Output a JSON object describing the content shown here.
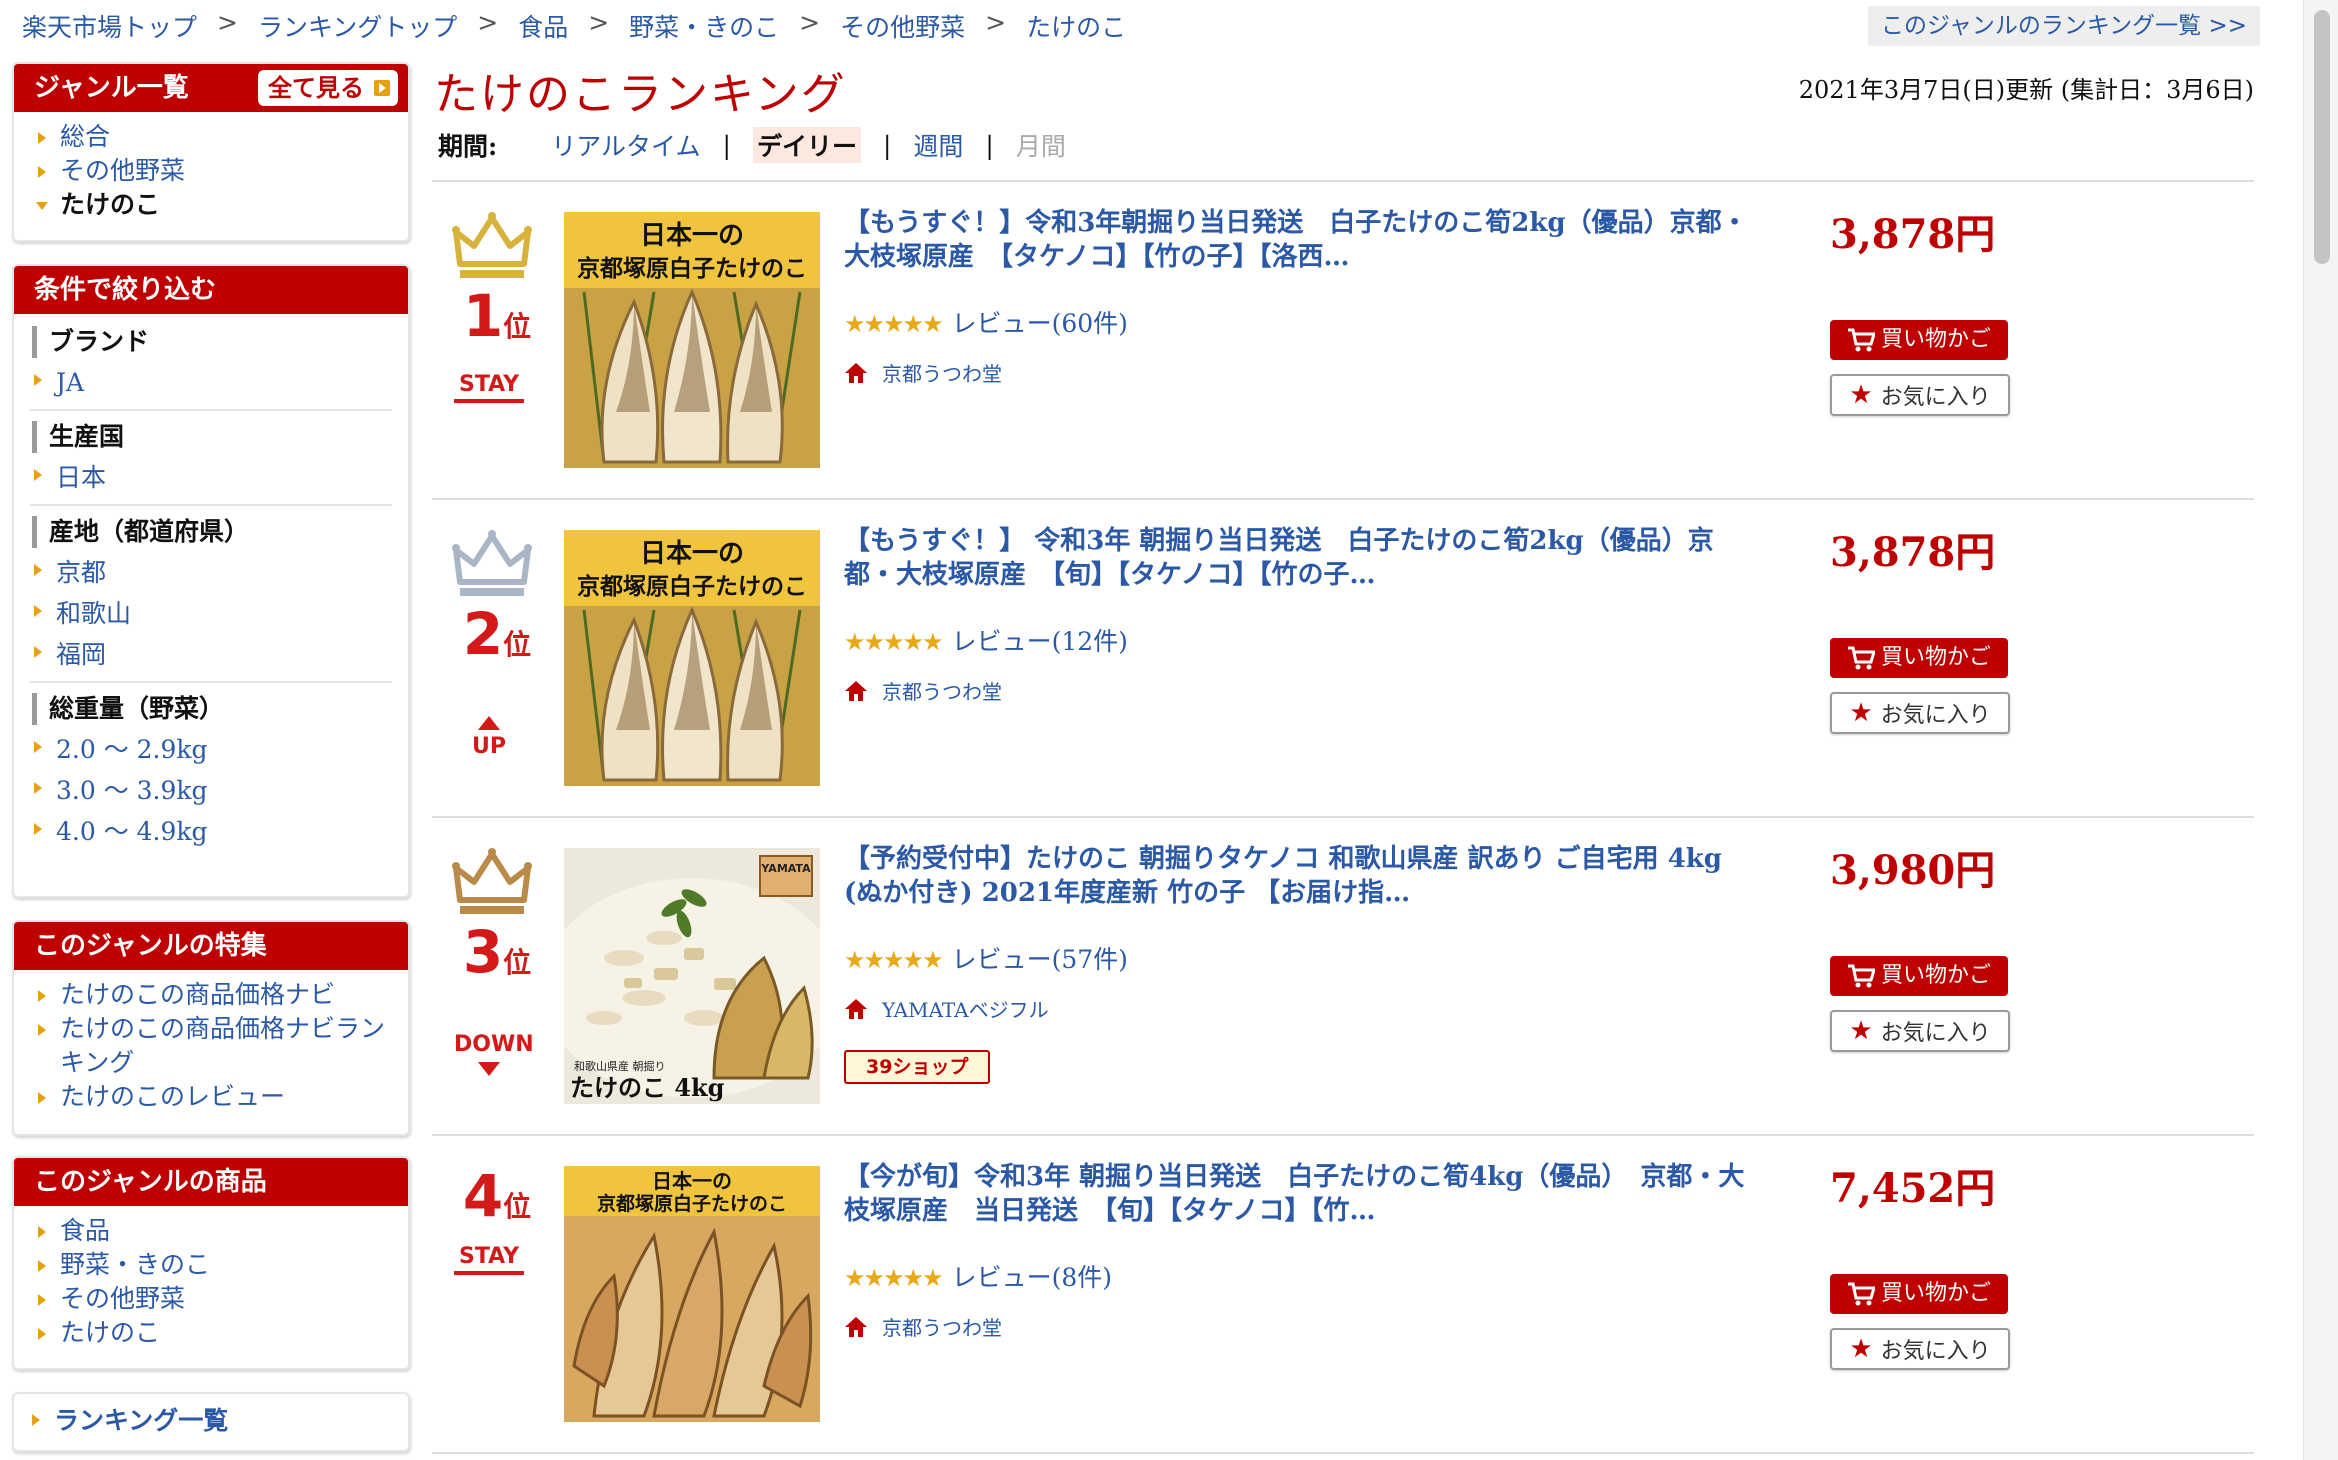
{
  "breadcrumb": [
    "楽天市場トップ",
    "ランキングトップ",
    "食品",
    "野菜・きのこ",
    "その他野菜",
    "たけのこ"
  ],
  "breadcrumb_separator": ">",
  "genre_ranking_link": "このジャンルのランキング一覧 >>",
  "sidebar": {
    "genre": {
      "title": "ジャンル一覧",
      "see_all": "全て見る",
      "items": [
        "総合",
        "その他野菜",
        "たけのこ"
      ]
    },
    "filter": {
      "title": "条件で絞り込む",
      "groups": [
        {
          "title": "ブランド",
          "items": [
            "JA"
          ]
        },
        {
          "title": "生産国",
          "items": [
            "日本"
          ]
        },
        {
          "title": "産地（都道府県）",
          "items": [
            "京都",
            "和歌山",
            "福岡"
          ]
        },
        {
          "title": "総重量（野菜）",
          "items": [
            "2.0 〜 2.9kg",
            "3.0 〜 3.9kg",
            "4.0 〜 4.9kg"
          ]
        }
      ]
    },
    "features": {
      "title": "このジャンルの特集",
      "items": [
        "たけのこの商品価格ナビ",
        "たけのこの商品価格ナビランキング",
        "たけのこのレビュー"
      ]
    },
    "products": {
      "title": "このジャンルの商品",
      "items": [
        "食品",
        "野菜・きのこ",
        "その他野菜",
        "たけのこ"
      ]
    },
    "ranking_list": "ランキング一覧"
  },
  "main": {
    "title": "たけのこランキング",
    "update_info": "2021年3月7日(日)更新 (集計日：3月6日)",
    "period": {
      "label": "期間:",
      "realtime": "リアルタイム",
      "daily": "デイリー",
      "weekly": "週間",
      "monthly": "月間",
      "separator": "|"
    }
  },
  "rankings": [
    {
      "rank": "1",
      "rank_suffix": "位",
      "change": "STAY",
      "title": "【もうすぐ！】令和3年朝掘り当日発送　白子たけのこ筍2kg（優品）京都・大枝塚原産　【タケノコ】【竹の子】【洛西…",
      "stars": "★★★★★",
      "rating": 4.5,
      "reviews": "レビュー(60件)",
      "shop": "京都うつわ堂",
      "price": "3,878円",
      "cart": "買い物かご",
      "favorite": "お気に入り",
      "image_text_top": "日本一の",
      "image_text_sub": "京都塚原白子たけのこ",
      "crown_color": "#d8b23a"
    },
    {
      "rank": "2",
      "rank_suffix": "位",
      "change": "UP",
      "title": "【もうすぐ！】 令和3年 朝掘り当日発送　白子たけのこ筍2kg（優品）京都・大枝塚原産　【旬】【タケノコ】【竹の子…",
      "stars": "★★★★★",
      "rating": 4.5,
      "reviews": "レビュー(12件)",
      "shop": "京都うつわ堂",
      "price": "3,878円",
      "cart": "買い物かご",
      "favorite": "お気に入り",
      "image_text_top": "日本一の",
      "image_text_sub": "京都塚原白子たけのこ",
      "crown_color": "#a9b6c6"
    },
    {
      "rank": "3",
      "rank_suffix": "位",
      "change": "DOWN",
      "title": "【予約受付中】たけのこ 朝掘りタケノコ 和歌山県産 訳あり ご自宅用 4kg (ぬか付き) 2021年度産新 竹の子 【お届け指…",
      "stars": "★★★★★",
      "rating": 4.5,
      "reviews": "レビュー(57件)",
      "shop": "YAMATAベジフル",
      "badge_39": "39ショップ",
      "price": "3,980円",
      "cart": "買い物かご",
      "favorite": "お気に入り",
      "image_text_caption": "たけのこ 4kg",
      "image_text_small": "和歌山県産 朝掘り",
      "image_text_brand": "YAMATA",
      "crown_color": "#b98a48"
    },
    {
      "rank": "4",
      "rank_suffix": "位",
      "change": "STAY",
      "title": "【今が旬】令和3年 朝掘り当日発送　白子たけのこ筍4kg（優品）　京都・大枝塚原産　当日発送　【旬】【タケノコ】【竹…",
      "stars": "★★★★★",
      "rating": 4.5,
      "reviews": "レビュー(8件)",
      "shop": "京都うつわ堂",
      "price": "7,452円",
      "cart": "買い物かご",
      "favorite": "お気に入り",
      "image_text_top": "日本一の",
      "image_text_sub": "京都塚原白子たけのこ"
    }
  ],
  "colors": {
    "brand_red": "#bf0000",
    "link_blue": "#2b59a6",
    "star_gold": "#e8a818",
    "arrow_orange": "#e8a010"
  }
}
